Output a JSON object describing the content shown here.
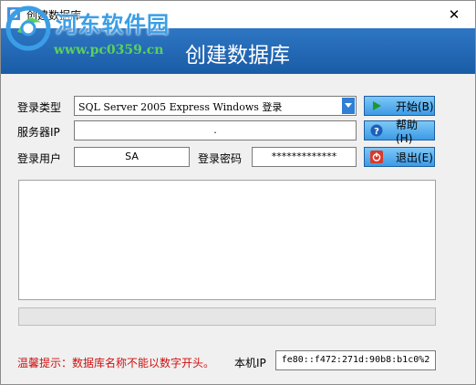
{
  "window": {
    "title": "创建数据库",
    "close_symbol": "✕"
  },
  "watermark": {
    "text": "河东软件园",
    "url": "www.pc0359.cn"
  },
  "banner": {
    "title": "创建数据库"
  },
  "form": {
    "login_type_label": "登录类型",
    "login_type_value": "SQL Server 2005 Express Windows 登录",
    "server_ip_label": "服务器IP",
    "server_ip_value": ".",
    "login_user_label": "登录用户",
    "login_user_value": "SA",
    "login_password_label": "登录密码",
    "login_password_value": "*************"
  },
  "buttons": {
    "start": "开始(B)",
    "help": "帮助(H)",
    "exit": "退出(E)"
  },
  "footer": {
    "tip": "温馨提示：数据库名称不能以数字开头。",
    "ip_label": "本机IP",
    "ip_value": "fe80::f472:271d:90b8:b1c0%2"
  },
  "colors": {
    "banner": "#1f64b0",
    "button": "#5cb4f0",
    "tip": "#d01010"
  }
}
